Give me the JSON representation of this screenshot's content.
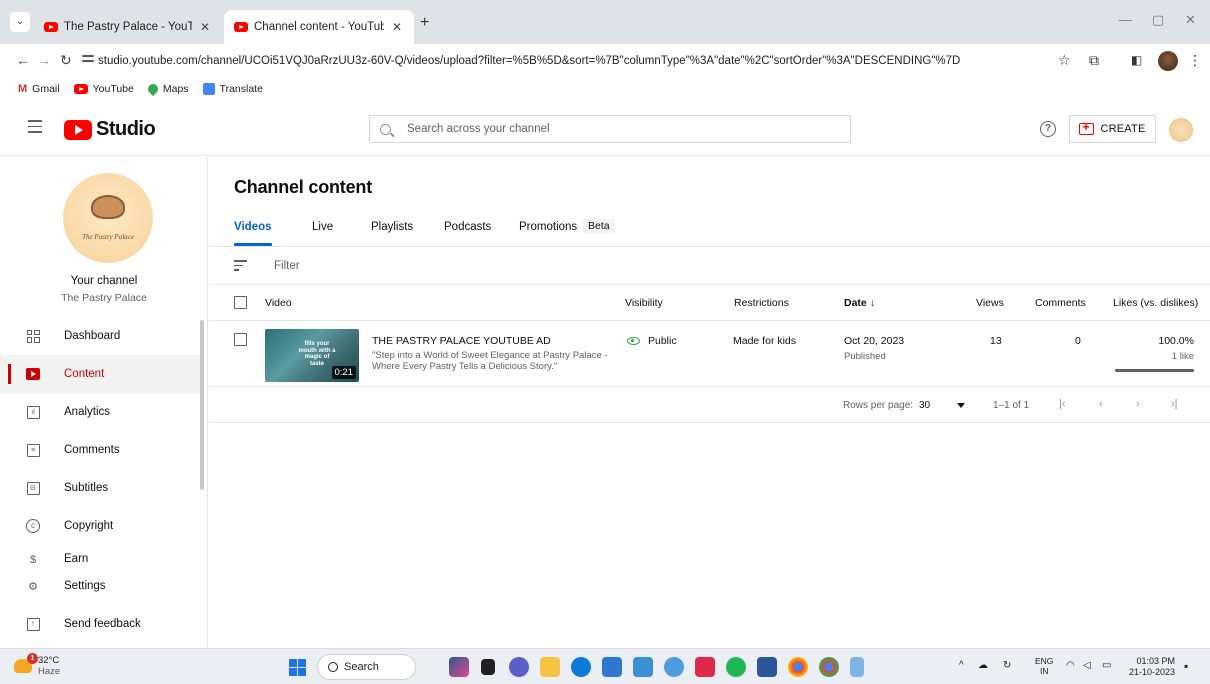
{
  "browser": {
    "tabs": [
      {
        "title": "The Pastry Palace - YouTube"
      },
      {
        "title": "Channel content - YouTube St"
      }
    ],
    "new_tab_symbol": "+",
    "url_host": "studio.youtube.com",
    "url_rest": "/channel/UCOi51VQJ0aRrzUU3z-60V-Q/videos/upload?filter=%5B%5D&sort=%7B\"columnType\"%3A\"date\"%2C\"sortOrder\"%3A\"DESCENDING\"%7D",
    "bookmarks": [
      "Gmail",
      "YouTube",
      "Maps",
      "Translate"
    ]
  },
  "studio": {
    "logo_text": "Studio",
    "search_placeholder": "Search across your channel",
    "create_label": "CREATE",
    "help_symbol": "?"
  },
  "sidebar": {
    "your_channel": "Your channel",
    "channel_name": "The Pastry Palace",
    "avatar_brand": "The Pastry Palace",
    "items": [
      {
        "label": "Dashboard",
        "icon": "dashboard-icon"
      },
      {
        "label": "Content",
        "icon": "content-icon",
        "active": true
      },
      {
        "label": "Analytics",
        "icon": "analytics-icon"
      },
      {
        "label": "Comments",
        "icon": "comments-icon"
      },
      {
        "label": "Subtitles",
        "icon": "subtitles-icon"
      },
      {
        "label": "Copyright",
        "icon": "copyright-icon"
      },
      {
        "label": "Earn",
        "icon": "earn-icon"
      },
      {
        "label": "Settings",
        "icon": "settings-icon"
      },
      {
        "label": "Send feedback",
        "icon": "feedback-icon"
      }
    ]
  },
  "main": {
    "title": "Channel content",
    "tabs": [
      "Videos",
      "Live",
      "Playlists",
      "Podcasts",
      "Promotions"
    ],
    "beta_label": "Beta",
    "filter_label": "Filter",
    "columns": {
      "video": "Video",
      "visibility": "Visibility",
      "restrictions": "Restrictions",
      "date": "Date",
      "views": "Views",
      "comments": "Comments",
      "likes": "Likes (vs. dislikes)"
    },
    "rows": [
      {
        "title": "THE PASTRY PALACE YOUTUBE AD",
        "description": "\"Step into a World of Sweet Elegance at Pastry Palace - Where Every Pastry Tells a Delicious Story.\"",
        "thumb_text": "fills your mouth with a magic of taste",
        "duration": "0:21",
        "visibility": "Public",
        "restrictions": "Made for kids",
        "date": "Oct 20, 2023",
        "date_status": "Published",
        "views": "13",
        "comments": "0",
        "likes_pct": "100.0%",
        "likes_count": "1 like",
        "likes_ratio": 1.0
      }
    ],
    "pager": {
      "rows_per_page_label": "Rows per page:",
      "rows_per_page": "30",
      "range": "1–1 of 1"
    }
  },
  "taskbar": {
    "temperature": "32°C",
    "weather": "Haze",
    "search_label": "Search",
    "lang_1": "ENG",
    "lang_2": "IN",
    "time": "01:03 PM",
    "date": "21-10-2023"
  },
  "colors": {
    "accent_blue": "#065fd4",
    "youtube_red": "#ff0000",
    "active_red": "#cc0000",
    "public_green": "#2ba640"
  }
}
